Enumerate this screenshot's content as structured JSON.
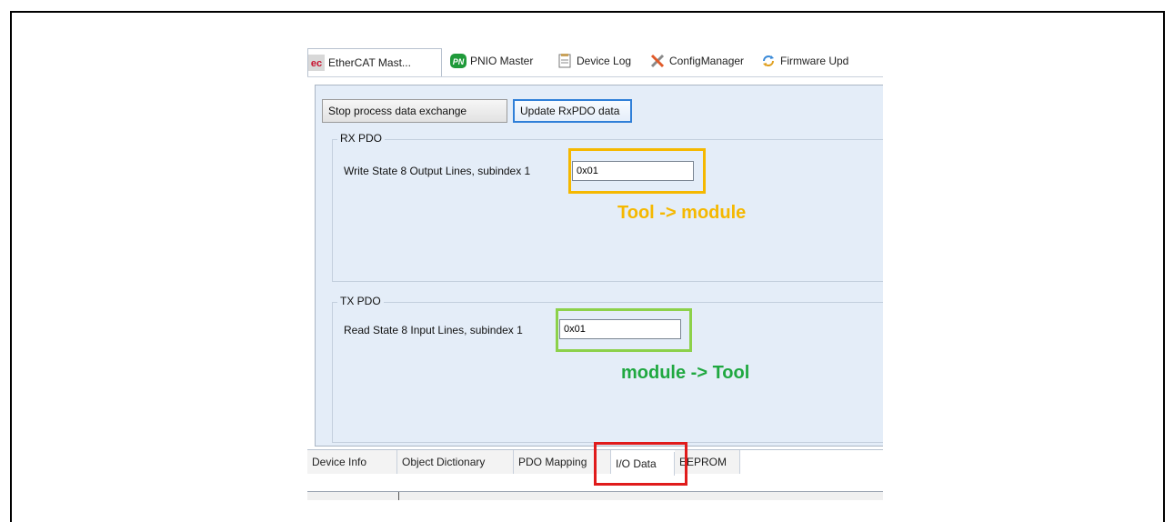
{
  "top_tabs": [
    {
      "label": "EtherCAT Mast...",
      "icon": "ethercat-icon"
    },
    {
      "label": "PNIO Master",
      "icon": "pnio-icon"
    },
    {
      "label": "Device Log",
      "icon": "document-icon"
    },
    {
      "label": "ConfigManager",
      "icon": "tools-icon"
    },
    {
      "label": "Firmware Upd",
      "icon": "firmware-icon"
    }
  ],
  "icon_text": {
    "ec": "ec",
    "pn": "PN"
  },
  "toolbar": {
    "stop_label": "Stop process data exchange",
    "update_label": "Update RxPDO data"
  },
  "rx_pdo": {
    "group_label": "RX PDO",
    "field_label": "Write State 8 Output Lines, subindex 1",
    "value": "0x01"
  },
  "tx_pdo": {
    "group_label": "TX PDO",
    "field_label": "Read State 8 Input Lines, subindex 1",
    "value": "0x01"
  },
  "annotations": {
    "rx_note": "Tool -> module",
    "tx_note": "module -> Tool",
    "rx_color": "#f5b800",
    "tx_color": "#1fa840",
    "tab_color": "#e01b1b"
  },
  "bottom_tabs": [
    {
      "label": "Device Info"
    },
    {
      "label": "Object Dictionary"
    },
    {
      "label": "PDO Mapping"
    },
    {
      "label": "I/O Data",
      "active": true
    },
    {
      "label": "EEPROM"
    }
  ]
}
